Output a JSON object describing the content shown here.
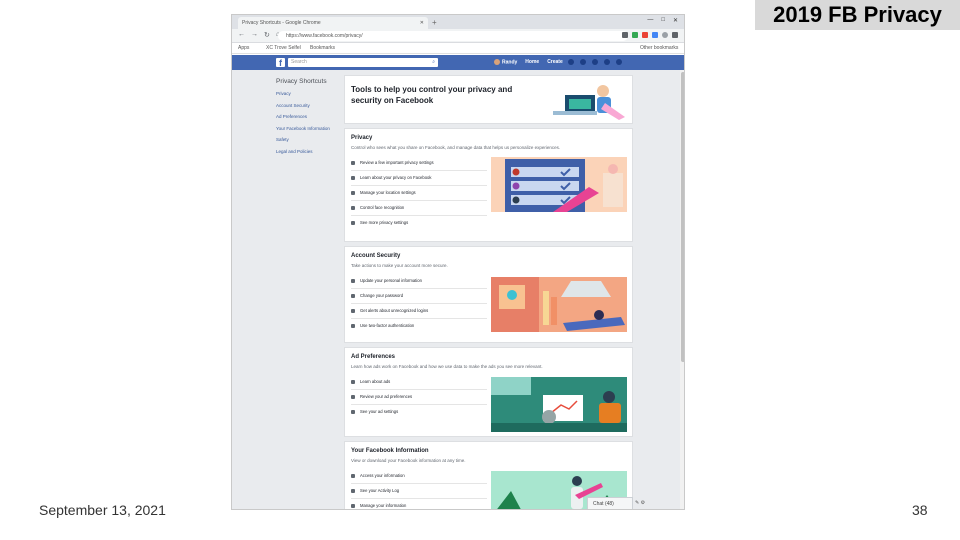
{
  "slide": {
    "title": "2019 FB Privacy",
    "date": "September 13, 2021",
    "page": "38"
  },
  "browser": {
    "tab_title": "Privacy Shortcuts - Google Chrome",
    "url": "https://www.facebook.com/privacy/",
    "bookmarks": [
      "Apps",
      "XC Trove Selfel",
      "Bookmarks",
      "Other bookmarks"
    ]
  },
  "facebook": {
    "search_placeholder": "Search",
    "nav": [
      "Randy",
      "Home",
      "Create"
    ]
  },
  "shortcuts": {
    "title": "Privacy Shortcuts",
    "links": [
      "Privacy",
      "Account Security",
      "Ad Preferences",
      "Your Facebook Information",
      "Safety",
      "Legal and Policies"
    ]
  },
  "intro": {
    "title": "Tools to help you control your privacy and security on Facebook"
  },
  "sections": [
    {
      "title": "Privacy",
      "subtitle": "Control who sees what you share on Facebook, and manage data that helps us personalize experiences.",
      "items": [
        "Review a few important privacy settings",
        "Learn about your privacy on Facebook",
        "Manage your location settings",
        "Control face recognition",
        "See more privacy settings"
      ]
    },
    {
      "title": "Account Security",
      "subtitle": "Take actions to make your account more secure.",
      "items": [
        "Update your personal information",
        "Change your password",
        "Get alerts about unrecognized logins",
        "Use two-factor authentication"
      ]
    },
    {
      "title": "Ad Preferences",
      "subtitle": "Learn how ads work on Facebook and how we use data to make the ads you see more relevant.",
      "items": [
        "Learn about ads",
        "Review your ad preferences",
        "See your ad settings"
      ]
    },
    {
      "title": "Your Facebook Information",
      "subtitle": "View or download your Facebook information at any time.",
      "items": [
        "Access your information",
        "See your Activity Log",
        "Manage your information"
      ]
    }
  ],
  "chat": {
    "label": "Chat (48)"
  },
  "colors": {
    "facebook_blue": "#4267b2",
    "page_bg": "#e9ebee",
    "link": "#365899"
  }
}
